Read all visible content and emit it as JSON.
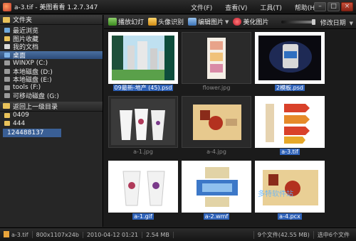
{
  "window": {
    "title": "a-3.tif - 美图看看 1.2.7.347"
  },
  "menu": [
    "文件(F)",
    "查看(V)",
    "工具(T)",
    "帮助(H)"
  ],
  "window_buttons": {
    "minimize": "–",
    "maximize": "□",
    "close": "×"
  },
  "sidebar": {
    "header": "文件夹",
    "items": [
      {
        "label": "最近浏览",
        "icon": "recent-icon"
      },
      {
        "label": "图片收藏",
        "icon": "favorites-icon"
      },
      {
        "label": "我的文档",
        "icon": "documents-icon"
      },
      {
        "label": "桌面",
        "icon": "desktop-icon",
        "selected": true
      },
      {
        "label": "WINXP (C:)",
        "icon": "drive-icon"
      },
      {
        "label": "本地磁盘 (D:)",
        "icon": "drive-icon"
      },
      {
        "label": "本地磁盘 (E:)",
        "icon": "drive-icon"
      },
      {
        "label": "tools (F:)",
        "icon": "drive-icon"
      },
      {
        "label": "可移动磁盘 (G:)",
        "icon": "drive-icon"
      }
    ],
    "history_header": "返回上一级目录",
    "folders": [
      "0409",
      "444"
    ],
    "current_path": "124488137"
  },
  "toolbar": {
    "slideshow": "播放幻灯",
    "face": "头像识别",
    "edit": "编辑图片",
    "beauty": "美化图片",
    "sort": "修改日期"
  },
  "thumbnails": [
    {
      "name": "09最新-地产 (45).psd",
      "selected": true,
      "tag": "PSD"
    },
    {
      "name": "flower.jpg",
      "selected": false,
      "tag": "JPG"
    },
    {
      "name": "2模板.psd",
      "selected": true,
      "tag": "PSD"
    },
    {
      "name": "a-1.jpg",
      "selected": false,
      "tag": ""
    },
    {
      "name": "a-4.jpg",
      "selected": false,
      "tag": ""
    },
    {
      "name": "a-3.tif",
      "selected": true,
      "tag": ""
    },
    {
      "name": "a-1.gif",
      "selected": true,
      "tag": ""
    },
    {
      "name": "a-2.wmf",
      "selected": true,
      "tag": ""
    },
    {
      "name": "a-4.pcx",
      "selected": true,
      "tag": ""
    }
  ],
  "status": {
    "file": "a-3.tif",
    "dimensions": "800x1107x24b",
    "date": "2010-04-12 01:21",
    "size": "2.54 MB",
    "summary": "9个文件(42.55 MB)",
    "selection": "选中6个文件"
  },
  "watermark": "多特软件站"
}
